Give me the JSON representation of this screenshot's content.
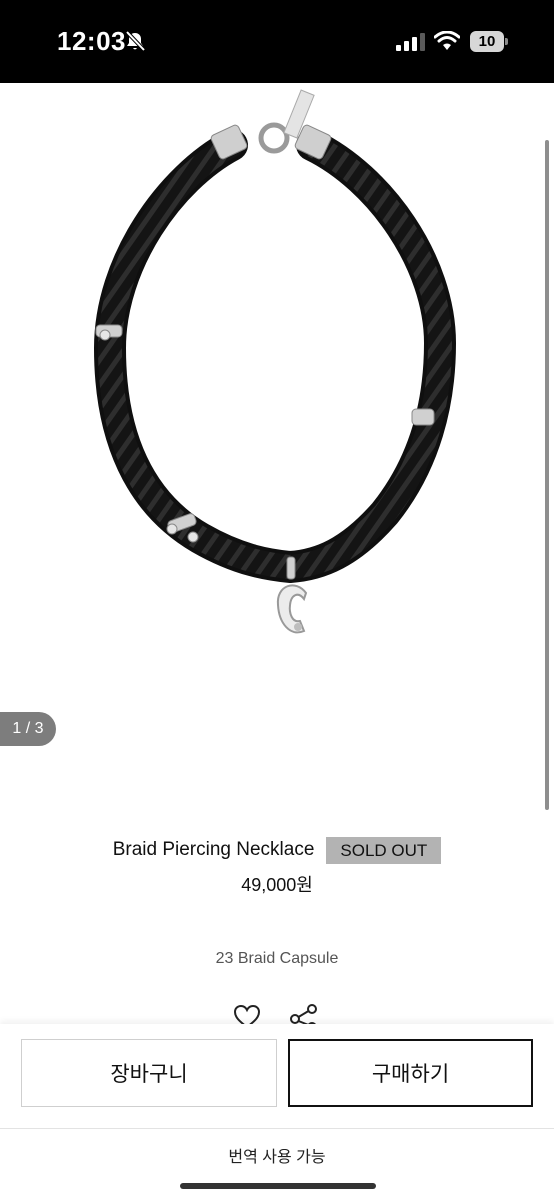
{
  "status_bar": {
    "time": "12:03",
    "battery": "10",
    "icons": [
      "bell-slash-icon",
      "signal-icon",
      "wifi-icon",
      "battery-icon"
    ]
  },
  "gallery": {
    "page_counter": "1 / 3",
    "image": "black-braided-rope-necklace-with-silver-c-pendant"
  },
  "product": {
    "name": "Braid Piercing Necklace",
    "badge": "SOLD OUT",
    "price": "49,000원",
    "collection": "23 Braid Capsule"
  },
  "actions": {
    "icons": [
      "heart-icon",
      "share-icon"
    ],
    "cart_label": "장바구니",
    "buy_label": "구매하기"
  },
  "translation": {
    "label": "번역 사용 가능"
  },
  "colors": {
    "status_bar": "#000000",
    "badge_bg": "#b3b3b3",
    "counter_bg": "#7d7d7d",
    "text": "#111111"
  }
}
